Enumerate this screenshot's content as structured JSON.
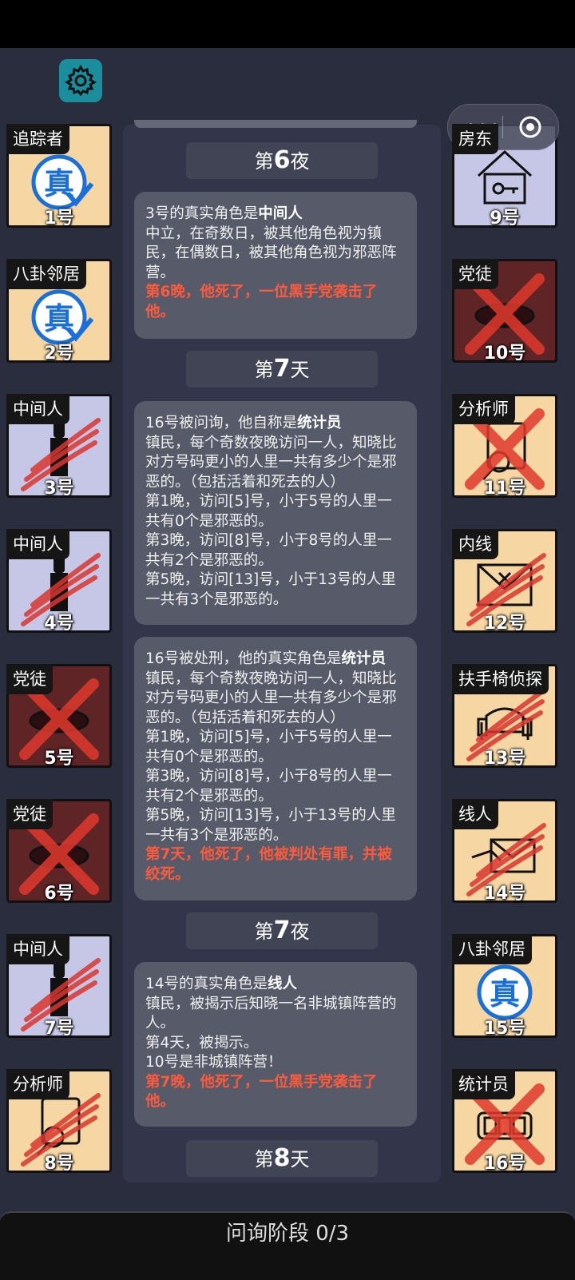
{
  "capsule": {
    "overlay_text": "房东",
    "dots": "•••"
  },
  "cards": [
    {
      "id": "1",
      "role": "追踪者",
      "label": "1号",
      "bg": "#f6d7a3",
      "state": "alive-true"
    },
    {
      "id": "2",
      "role": "八卦邻居",
      "label": "2号",
      "bg": "#f6d7a3",
      "state": "alive-true"
    },
    {
      "id": "3",
      "role": "中间人",
      "label": "3号",
      "bg": "#c6c6e6",
      "state": "clawed"
    },
    {
      "id": "4",
      "role": "中间人",
      "label": "4号",
      "bg": "#c6c6e6",
      "state": "clawed"
    },
    {
      "id": "5",
      "role": "党徒",
      "label": "5号",
      "bg": "#5e2426",
      "state": "crossed"
    },
    {
      "id": "6",
      "role": "党徒",
      "label": "6号",
      "bg": "#5e2426",
      "state": "crossed"
    },
    {
      "id": "7",
      "role": "中间人",
      "label": "7号",
      "bg": "#c6c6e6",
      "state": "clawed"
    },
    {
      "id": "8",
      "role": "分析师",
      "label": "8号",
      "bg": "#f6d7a3",
      "state": "clawed"
    },
    {
      "id": "9",
      "role": "房东",
      "label": "9号",
      "bg": "#c6c6e6",
      "state": "alive"
    },
    {
      "id": "10",
      "role": "党徒",
      "label": "10号",
      "bg": "#5e2426",
      "state": "crossed"
    },
    {
      "id": "11",
      "role": "分析师",
      "label": "11号",
      "bg": "#f6d7a3",
      "state": "crossed"
    },
    {
      "id": "12",
      "role": "内线",
      "label": "12号",
      "bg": "#f6d7a3",
      "state": "clawed"
    },
    {
      "id": "13",
      "role": "扶手椅侦探",
      "label": "13号",
      "bg": "#f6d7a3",
      "state": "clawed"
    },
    {
      "id": "14",
      "role": "线人",
      "label": "14号",
      "bg": "#f6d7a3",
      "state": "clawed"
    },
    {
      "id": "15",
      "role": "八卦邻居",
      "label": "15号",
      "bg": "#f6d7a3",
      "state": "alive"
    },
    {
      "id": "16",
      "role": "统计员",
      "label": "16号",
      "bg": "#f6d7a3",
      "state": "crossed"
    }
  ],
  "headers": [
    {
      "prefix": "第",
      "num": "6",
      "suffix": "夜"
    },
    {
      "prefix": "第",
      "num": "7",
      "suffix": "天"
    },
    {
      "prefix": "第",
      "num": "7",
      "suffix": "夜"
    },
    {
      "prefix": "第",
      "num": "8",
      "suffix": "天"
    }
  ],
  "messages": [
    {
      "line1": "3号的真实角色是",
      "bold1": "中间人",
      "body": "中立，在奇数日，被其他角色视为镇民，在偶数日，被其他角色视为邪恶阵营。",
      "red": "第6晚，他死了，一位黑手党袭击了他。"
    },
    {
      "line1": "16号被问询，他自称是",
      "bold1": "统计员",
      "body": "镇民，每个奇数夜晚访问一人，知晓比对方号码更小的人里一共有多少个是邪恶的。（包括活着和死去的人）",
      "l1": "第1晚，访问[5]号，小于5号的人里一共有0个是邪恶的。",
      "l2": "第3晚，访问[8]号，小于8号的人里一共有2个是邪恶的。",
      "l3": "第5晚，访问[13]号，小于13号的人里一共有3个是邪恶的。"
    },
    {
      "line1": "16号被处刑，他的真实角色是",
      "bold1": "统计员",
      "body": "镇民，每个奇数夜晚访问一人，知晓比对方号码更小的人里一共有多少个是邪恶的。（包括活着和死去的人）",
      "l1": "第1晚，访问[5]号，小于5号的人里一共有0个是邪恶的。",
      "l2": "第3晚，访问[8]号，小于8号的人里一共有2个是邪恶的。",
      "l3": "第5晚，访问[13]号，小于13号的人里一共有3个是邪恶的。",
      "red": "第7天，他死了，他被判处有罪，并被绞死。"
    },
    {
      "line1": "14号的真实角色是",
      "bold1": "线人",
      "body": "镇民，被揭示后知晓一名非城镇阵营的人。",
      "l1": "第4天，被揭示。",
      "l2": "10号是非城镇阵营！",
      "red": "第7晚，他死了，一位黑手党袭击了他。"
    }
  ],
  "bottom_bar": {
    "label": "问询阶段 0/3"
  },
  "colors": {
    "claw": "#d9372f",
    "cross": "#e0392c",
    "alert_text": "#ff5a3c",
    "gear": "#1b8e9e"
  }
}
